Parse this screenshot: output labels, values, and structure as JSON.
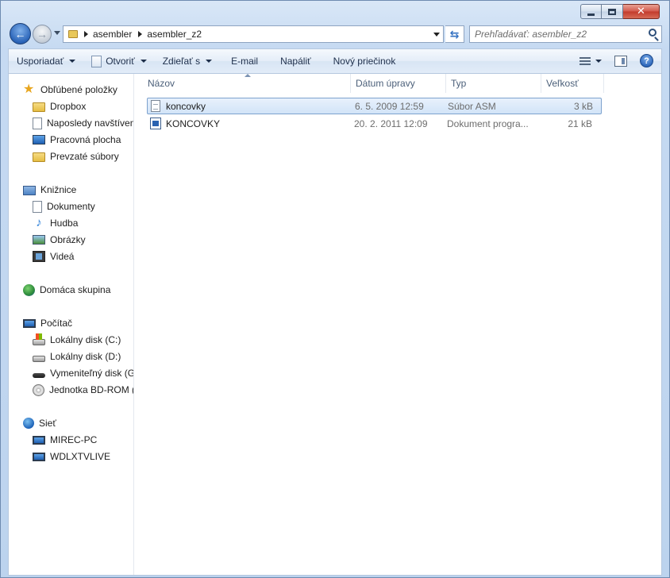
{
  "window": {
    "close_glyph": "✕"
  },
  "navigation": {
    "back_glyph": "←",
    "forward_glyph": "→",
    "refresh_glyph": "⇆"
  },
  "address": {
    "crumbs": [
      "asembler",
      "asembler_z2"
    ]
  },
  "search": {
    "placeholder": "Prehľadávať: asembler_z2"
  },
  "toolbar": {
    "organize": "Usporiadať",
    "open": "Otvoriť",
    "share": "Zdieľať s",
    "email": "E-mail",
    "burn": "Napáliť",
    "new_folder": "Nový priečinok",
    "help_glyph": "?"
  },
  "sidebar": {
    "favorites": {
      "title": "Obľúbené položky",
      "items": [
        "Dropbox",
        "Naposledy navštívené",
        "Pracovná plocha",
        "Prevzaté súbory"
      ]
    },
    "libraries": {
      "title": "Knižnice",
      "items": [
        "Dokumenty",
        "Hudba",
        "Obrázky",
        "Videá"
      ]
    },
    "homegroup": {
      "title": "Domáca skupina"
    },
    "computer": {
      "title": "Počítač",
      "items": [
        "Lokálny disk (C:)",
        "Lokálny disk (D:)",
        "Vymeniteľný disk (G:)",
        "Jednotka BD-ROM (E:)"
      ]
    },
    "network": {
      "title": "Sieť",
      "items": [
        "MIREC-PC",
        "WDLXTVLIVE"
      ]
    }
  },
  "columns": {
    "name": "Názov",
    "date": "Dátum úpravy",
    "type": "Typ",
    "size": "Veľkosť"
  },
  "files": [
    {
      "name": "koncovky",
      "date": "6. 5. 2009 12:59",
      "type": "Súbor ASM",
      "size": "3 kB",
      "icon": "text-file-icon"
    },
    {
      "name": "KONCOVKY",
      "date": "20. 2. 2011 12:09",
      "type": "Dokument progra...",
      "size": "21 kB",
      "icon": "executable-file-icon"
    }
  ],
  "colors": {
    "selection_border": "#7da2ce",
    "selection_fill": "#d2e4f8",
    "close_button": "#c23a2b"
  }
}
